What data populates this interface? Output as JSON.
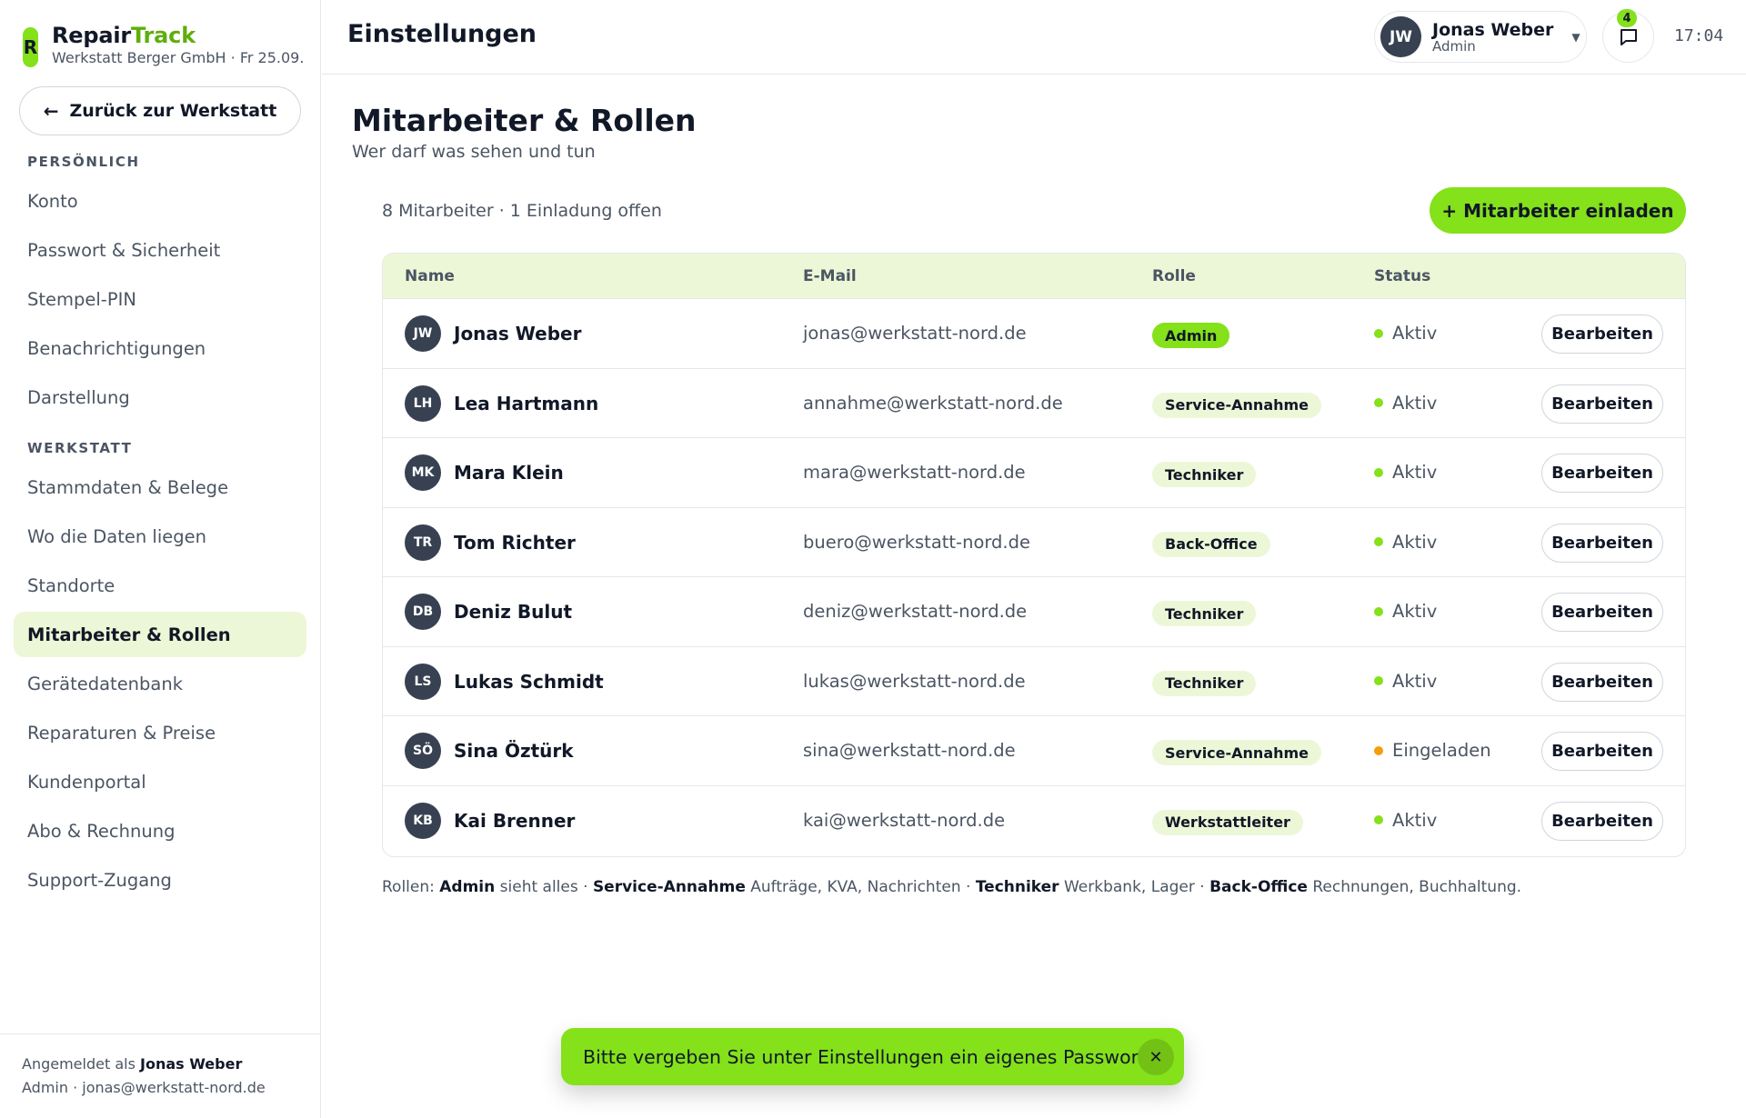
{
  "brand": {
    "logo_letter": "R",
    "name_part1": "Repair",
    "name_part2": "Track",
    "subtitle": "Werkstatt Berger GmbH · Fr 25.09."
  },
  "sidebar": {
    "back_label": "Zurück zur Werkstatt",
    "sections": [
      {
        "label": "PERSÖNLICH",
        "items": [
          "Konto",
          "Passwort & Sicherheit",
          "Stempel-PIN",
          "Benachrichtigungen",
          "Darstellung"
        ]
      },
      {
        "label": "WERKSTATT",
        "items": [
          "Stammdaten & Belege",
          "Wo die Daten liegen",
          "Standorte",
          "Mitarbeiter & Rollen",
          "Gerätedatenbank",
          "Reparaturen & Preise",
          "Kundenportal",
          "Abo & Rechnung",
          "Support-Zugang"
        ]
      }
    ],
    "active_item": "Mitarbeiter & Rollen",
    "footer": {
      "logged_in_prefix": "Angemeldet als",
      "logged_in_name": "Jonas Weber",
      "detail": "Admin · jonas@werkstatt-nord.de"
    }
  },
  "topbar": {
    "title": "Einstellungen",
    "user": {
      "initials": "JW",
      "name": "Jonas Weber",
      "role": "Admin"
    },
    "notifications_count": "4",
    "time": "17:04"
  },
  "main": {
    "title": "Mitarbeiter & Rollen",
    "subtitle": "Wer darf was sehen und tun",
    "count_text": "8 Mitarbeiter · 1 Einladung offen",
    "invite_label": "+ Mitarbeiter einladen",
    "table": {
      "headers": {
        "name": "Name",
        "email": "E-Mail",
        "role": "Rolle",
        "status": "Status"
      },
      "edit_label": "Bearbeiten",
      "rows": [
        {
          "initials": "JW",
          "name": "Jonas Weber",
          "email": "jonas@werkstatt-nord.de",
          "role": "Admin",
          "status": "Aktiv"
        },
        {
          "initials": "LH",
          "name": "Lea Hartmann",
          "email": "annahme@werkstatt-nord.de",
          "role": "Service-Annahme",
          "status": "Aktiv"
        },
        {
          "initials": "MK",
          "name": "Mara Klein",
          "email": "mara@werkstatt-nord.de",
          "role": "Techniker",
          "status": "Aktiv"
        },
        {
          "initials": "TR",
          "name": "Tom Richter",
          "email": "buero@werkstatt-nord.de",
          "role": "Back-Office",
          "status": "Aktiv"
        },
        {
          "initials": "DB",
          "name": "Deniz Bulut",
          "email": "deniz@werkstatt-nord.de",
          "role": "Techniker",
          "status": "Aktiv"
        },
        {
          "initials": "LS",
          "name": "Lukas Schmidt",
          "email": "lukas@werkstatt-nord.de",
          "role": "Techniker",
          "status": "Aktiv"
        },
        {
          "initials": "SÖ",
          "name": "Sina Öztürk",
          "email": "sina@werkstatt-nord.de",
          "role": "Service-Annahme",
          "status": "Eingeladen"
        },
        {
          "initials": "KB",
          "name": "Kai Brenner",
          "email": "kai@werkstatt-nord.de",
          "role": "Werkstattleiter",
          "status": "Aktiv"
        }
      ]
    },
    "legend": {
      "prefix": "Rollen:",
      "items": [
        {
          "role": "Admin",
          "desc": "sieht alles"
        },
        {
          "role": "Service-Annahme",
          "desc": "Aufträge, KVA, Nachrichten"
        },
        {
          "role": "Techniker",
          "desc": "Werkbank, Lager"
        },
        {
          "role": "Back-Office",
          "desc": "Rechnungen, Buchhaltung."
        }
      ]
    }
  },
  "toast": {
    "text": "Bitte vergeben Sie unter Einstellungen ein eigenes Passwort.",
    "close_glyph": "✕"
  },
  "colors": {
    "accent": "#84e11a",
    "accent_soft": "#ecf7d7",
    "brand_green": "#5fae0c",
    "status_active": "#84e11a",
    "status_pending": "#f59e0b",
    "avatar_bg": "#374151"
  }
}
